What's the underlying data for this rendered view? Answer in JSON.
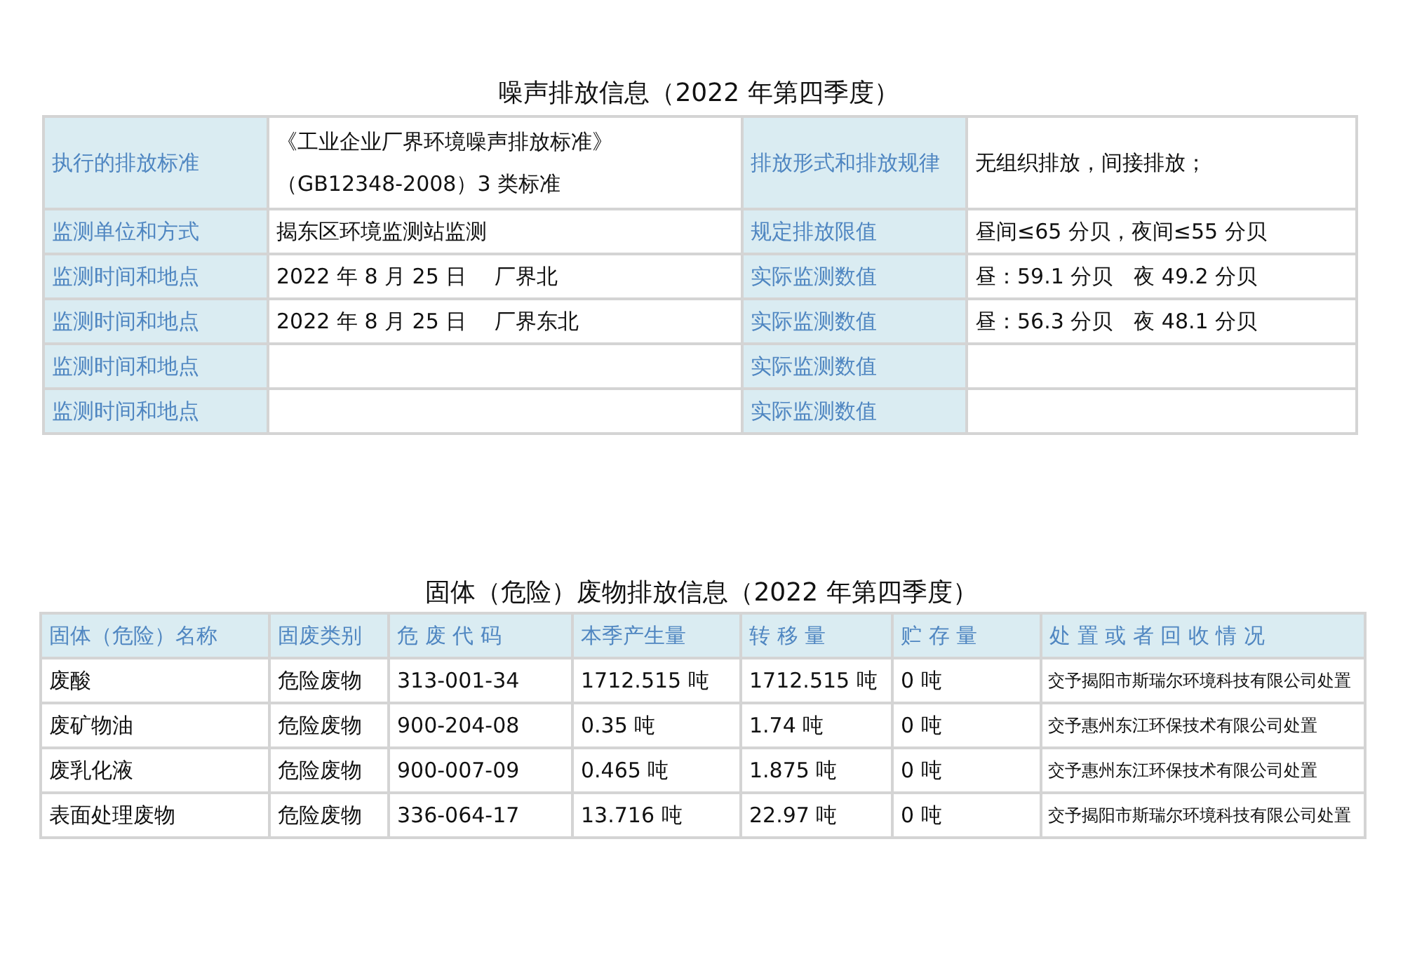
{
  "noise_section": {
    "title": "噪声排放信息（2022 年第四季度）",
    "rows": [
      {
        "label": "执行的排放标准",
        "value": "《工业企业厂界环境噪声排放标准》（GB12348-2008）3 类标准",
        "label_2": "排放形式和排放规律",
        "value_2": "无组织排放，间接排放；"
      },
      {
        "label": "监测单位和方式",
        "value": "揭东区环境监测站监测",
        "label_2": "规定排放限值",
        "value_2": "昼间≤65 分贝，夜间≤55 分贝"
      },
      {
        "label": "监测时间和地点",
        "value": "2022 年 8 月 25 日　 厂界北",
        "label_2": "实际监测数值",
        "value_2": "昼：59.1 分贝　夜 49.2 分贝"
      },
      {
        "label": "监测时间和地点",
        "value": "2022 年 8 月 25 日　 厂界东北",
        "label_2": "实际监测数值",
        "value_2": "昼：56.3 分贝　夜 48.1 分贝"
      },
      {
        "label": "监测时间和地点",
        "label_2": "实际监测数值"
      },
      {
        "label": "监测时间和地点",
        "label_2": "实际监测数值"
      }
    ]
  },
  "waste_section": {
    "title": "固体（危险）废物排放信息（2022 年第四季度）",
    "columns": [
      "固体（危险）名称",
      "固废类别",
      "危 废 代 码",
      "本季产生量",
      "转 移 量",
      "贮 存 量",
      "处 置 或 者 回 收 情 况"
    ],
    "rows": [
      [
        "废酸",
        "危险废物",
        "313-001-34",
        "1712.515 吨",
        "1712.515 吨",
        "0 吨",
        "交予揭阳市斯瑞尔环境科技有限公司处置"
      ],
      [
        "废矿物油",
        "危险废物",
        "900-204-08",
        "0.35 吨",
        "1.74 吨",
        "0 吨",
        "交予惠州东江环保技术有限公司处置"
      ],
      [
        "废乳化液",
        "危险废物",
        "900-007-09",
        "0.465 吨",
        "1.875 吨",
        "0 吨",
        "交予惠州东江环保技术有限公司处置"
      ],
      [
        "表面处理废物",
        "危险废物",
        "336-064-17",
        "13.716 吨",
        "22.97 吨",
        "0 吨",
        "交予揭阳市斯瑞尔环境科技有限公司处置"
      ]
    ]
  }
}
